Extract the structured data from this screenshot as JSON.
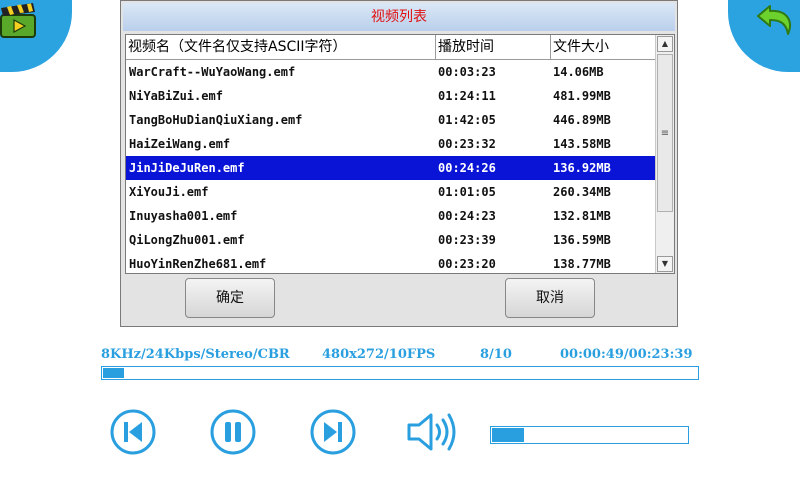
{
  "dialog": {
    "title": "视频列表",
    "columns": [
      "视频名（文件名仅支持ASCII字符）",
      "播放时间",
      "文件大小"
    ],
    "rows": [
      {
        "name": "WarCraft--WuYaoWang.emf",
        "duration": "00:03:23",
        "size": "14.06MB"
      },
      {
        "name": "NiYaBiZui.emf",
        "duration": "01:24:11",
        "size": "481.99MB"
      },
      {
        "name": "TangBoHuDianQiuXiang.emf",
        "duration": "01:42:05",
        "size": "446.89MB"
      },
      {
        "name": "HaiZeiWang.emf",
        "duration": "00:23:32",
        "size": "143.58MB"
      },
      {
        "name": "JinJiDeJuRen.emf",
        "duration": "00:24:26",
        "size": "136.92MB"
      },
      {
        "name": "XiYouJi.emf",
        "duration": "01:01:05",
        "size": "260.34MB"
      },
      {
        "name": "Inuyasha001.emf",
        "duration": "00:24:23",
        "size": "132.81MB"
      },
      {
        "name": "QiLongZhu001.emf",
        "duration": "00:23:39",
        "size": "136.59MB"
      },
      {
        "name": "HuoYinRenZhe681.emf",
        "duration": "00:23:20",
        "size": "138.77MB"
      }
    ],
    "selected_index": 4,
    "ok_label": "确定",
    "cancel_label": "取消"
  },
  "player": {
    "format": "8KHz/24Kbps/Stereo/CBR",
    "resolution": "480x272/10FPS",
    "track": "8/10",
    "time": "00:00:49/00:23:39",
    "progress_fraction": 0.035,
    "volume_fraction": 0.16
  },
  "icons": {
    "top_left": "movie-clapper-icon",
    "top_right": "back-arrow-icon",
    "controls": [
      "previous-icon",
      "pause-icon",
      "next-icon",
      "speaker-icon"
    ]
  },
  "colors": {
    "accent": "#2aa3e0",
    "selection": "#0a14d6",
    "title_text": "#e01010"
  }
}
